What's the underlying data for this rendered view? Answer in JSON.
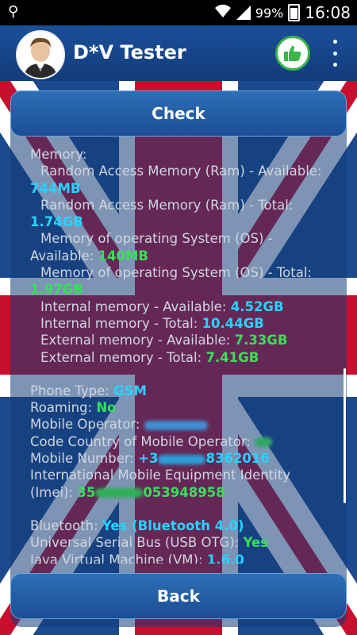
{
  "status_bar": {
    "battery_percent": "99%",
    "time": "16:08",
    "icons": [
      "usb-icon",
      "wifi-icon",
      "signal-icon",
      "battery-icon"
    ]
  },
  "app_bar": {
    "title": "D*V Tester",
    "icons": [
      "avatar",
      "thumbs-up-icon",
      "overflow-menu-icon"
    ],
    "accent": "#1b4f9a",
    "thumb_color": "#39b54a"
  },
  "panel": {
    "check_label": "Check",
    "back_label": "Back",
    "memory": {
      "header": "Memory:",
      "ram_avail_label": "Random Access Memory (Ram) - Available:",
      "ram_avail_value": "744MB",
      "ram_total_label": "Random Access Memory (Ram) - Total:",
      "ram_total_value": "1.74GB",
      "os_avail_label": "Memory of operating System (OS) - Available:",
      "os_avail_value": "140MB",
      "os_total_label": "Memory of operating System (OS) - Total:",
      "os_total_value": "1.97GB",
      "int_avail_label": "Internal memory - Available:",
      "int_avail_value": "4.52GB",
      "int_total_label": "Internal memory - Total:",
      "int_total_value": "10.44GB",
      "ext_avail_label": "External memory - Available:",
      "ext_avail_value": "7.33GB",
      "ext_total_label": "External memory - Total:",
      "ext_total_value": "7.41GB"
    },
    "phone": {
      "type_label": "Phone Type:",
      "type_value": "GSM",
      "roaming_label": "Roaming:",
      "roaming_value": "No",
      "operator_label": "Mobile Operator:",
      "code_label": "Code Country of Mobile Operator:",
      "number_label": "Mobile Number:",
      "number_prefix": "+3",
      "number_suffix": "8362016",
      "imei_label": "International Mobile Equipment Identity (Imei):",
      "imei_prefix": "35",
      "imei_suffix": "053948958"
    },
    "other": {
      "bt_label": "Bluetooth:",
      "bt_value": "Yes (Bluetooth 4.0)",
      "usb_label": "Universal Serial Bus (USB OTG):",
      "usb_value": "Yes",
      "jvm_label": "Java Virtual Machine (VM):",
      "jvm_value": "1.6.0"
    }
  }
}
